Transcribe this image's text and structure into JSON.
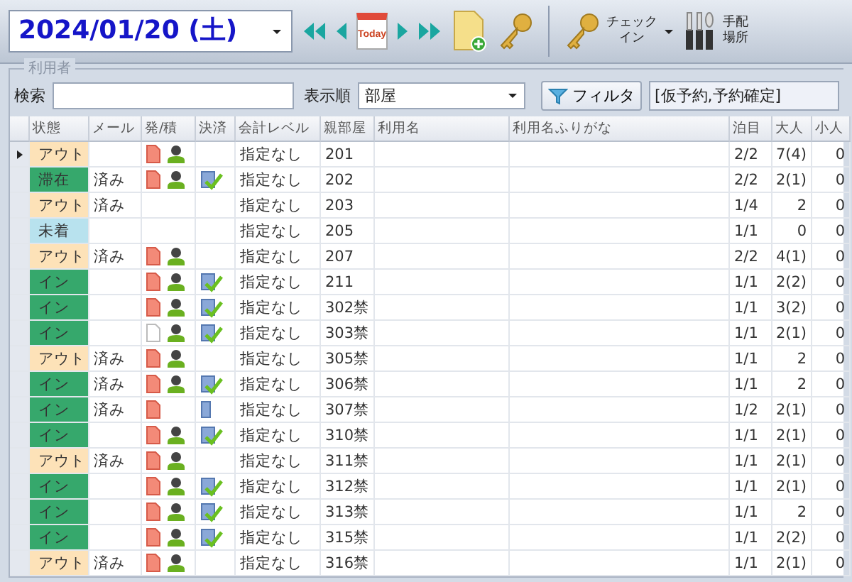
{
  "toolbar": {
    "date": "2024/01/20 (土)",
    "today": "Today",
    "checkin": [
      "チェック",
      "イン"
    ],
    "arrange": [
      "手配",
      "場所"
    ]
  },
  "group_title": "利用者",
  "search": {
    "label": "検索"
  },
  "sort": {
    "label": "表示順",
    "value": "部屋"
  },
  "filter": {
    "button": "フィルタ",
    "value": "[仮予約,予約確定]"
  },
  "table": {
    "columns": [
      "状態",
      "メール",
      "発/積",
      "決済",
      "会計レベル",
      "親部屋",
      "利用名",
      "利用名ふりがな",
      "泊目",
      "大人",
      "小人"
    ],
    "rows": [
      {
        "selected": true,
        "status": "アウト",
        "color": "#fde2b8",
        "doc": {
          "kind": "filled"
        },
        "person": true,
        "level": "指定なし",
        "room": "201",
        "night": "2/2",
        "adults": "7(4)",
        "children": "0"
      },
      {
        "selected": false,
        "status": "滞在",
        "color": "#36a86c",
        "mail": "済み",
        "doc": {
          "kind": "filled"
        },
        "person": true,
        "payment": {
          "kind": "done"
        },
        "level": "指定なし",
        "room": "202",
        "night": "2/2",
        "adults": "2(1)",
        "children": "0"
      },
      {
        "selected": false,
        "status": "アウト",
        "color": "#fde2b8",
        "mail": "済み",
        "person": false,
        "level": "指定なし",
        "room": "203",
        "night": "1/4",
        "adults": "2",
        "children": "0"
      },
      {
        "selected": false,
        "status": "未着",
        "color": "#b8e2ee",
        "person": false,
        "level": "指定なし",
        "room": "205",
        "night": "1/1",
        "adults": "0",
        "children": "0"
      },
      {
        "selected": false,
        "status": "アウト",
        "color": "#fde2b8",
        "mail": "済み",
        "doc": {
          "kind": "filled"
        },
        "person": true,
        "level": "指定なし",
        "room": "207",
        "night": "2/2",
        "adults": "4(1)",
        "children": "0"
      },
      {
        "selected": false,
        "status": "イン",
        "color": "#36a86c",
        "doc": {
          "kind": "filled"
        },
        "person": true,
        "payment": {
          "kind": "done"
        },
        "level": "指定なし",
        "room": "211",
        "night": "1/1",
        "adults": "2(2)",
        "children": "0"
      },
      {
        "selected": false,
        "status": "イン",
        "color": "#36a86c",
        "doc": {
          "kind": "filled"
        },
        "person": true,
        "payment": {
          "kind": "done"
        },
        "level": "指定なし",
        "room": "302禁",
        "night": "1/1",
        "adults": "3(2)",
        "children": "0"
      },
      {
        "selected": false,
        "status": "イン",
        "color": "#36a86c",
        "doc": {
          "kind": "blank"
        },
        "person": true,
        "payment": {
          "kind": "done"
        },
        "level": "指定なし",
        "room": "303禁",
        "night": "1/1",
        "adults": "2(1)",
        "children": "0"
      },
      {
        "selected": false,
        "status": "アウト",
        "color": "#fde2b8",
        "mail": "済み",
        "doc": {
          "kind": "filled"
        },
        "person": true,
        "level": "指定なし",
        "room": "305禁",
        "night": "1/1",
        "adults": "2",
        "children": "0"
      },
      {
        "selected": false,
        "status": "イン",
        "color": "#36a86c",
        "mail": "済み",
        "doc": {
          "kind": "filled"
        },
        "person": true,
        "payment": {
          "kind": "done"
        },
        "level": "指定なし",
        "room": "306禁",
        "night": "1/1",
        "adults": "2",
        "children": "0"
      },
      {
        "selected": false,
        "status": "イン",
        "color": "#36a86c",
        "mail": "済み",
        "doc": {
          "kind": "filled"
        },
        "person": false,
        "payment": {
          "kind": "card"
        },
        "level": "指定なし",
        "room": "307禁",
        "night": "1/2",
        "adults": "2(1)",
        "children": "0"
      },
      {
        "selected": false,
        "status": "イン",
        "color": "#36a86c",
        "doc": {
          "kind": "filled"
        },
        "person": true,
        "payment": {
          "kind": "done"
        },
        "level": "指定なし",
        "room": "310禁",
        "night": "1/1",
        "adults": "2(1)",
        "children": "0"
      },
      {
        "selected": false,
        "status": "アウト",
        "color": "#fde2b8",
        "mail": "済み",
        "doc": {
          "kind": "filled"
        },
        "person": true,
        "level": "指定なし",
        "room": "311禁",
        "night": "1/1",
        "adults": "2(1)",
        "children": "0"
      },
      {
        "selected": false,
        "status": "イン",
        "color": "#36a86c",
        "doc": {
          "kind": "filled"
        },
        "person": true,
        "payment": {
          "kind": "done"
        },
        "level": "指定なし",
        "room": "312禁",
        "night": "1/1",
        "adults": "2(1)",
        "children": "0"
      },
      {
        "selected": false,
        "status": "イン",
        "color": "#36a86c",
        "doc": {
          "kind": "filled"
        },
        "person": true,
        "payment": {
          "kind": "done"
        },
        "level": "指定なし",
        "room": "313禁",
        "night": "1/1",
        "adults": "2",
        "children": "0"
      },
      {
        "selected": false,
        "status": "イン",
        "color": "#36a86c",
        "doc": {
          "kind": "filled"
        },
        "person": true,
        "payment": {
          "kind": "done"
        },
        "level": "指定なし",
        "room": "315禁",
        "night": "1/1",
        "adults": "2(2)",
        "children": "0"
      },
      {
        "selected": false,
        "status": "アウト",
        "color": "#fde2b8",
        "mail": "済み",
        "doc": {
          "kind": "filled"
        },
        "person": true,
        "level": "指定なし",
        "room": "316禁",
        "night": "1/1",
        "adults": "2(1)",
        "children": "0"
      }
    ]
  }
}
